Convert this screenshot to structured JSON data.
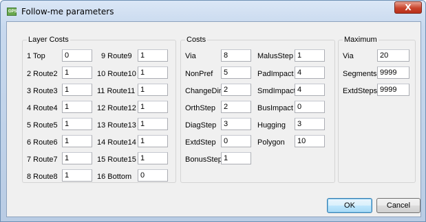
{
  "window": {
    "title": "Follow-me parameters",
    "close_glyph": "X"
  },
  "layer_costs": {
    "title": "Layer Costs",
    "left": [
      {
        "label": "1 Top",
        "value": "0"
      },
      {
        "label": "2 Route2",
        "value": "1"
      },
      {
        "label": "3 Route3",
        "value": "1"
      },
      {
        "label": "4 Route4",
        "value": "1"
      },
      {
        "label": "5 Route5",
        "value": "1"
      },
      {
        "label": "6 Route6",
        "value": "1"
      },
      {
        "label": "7 Route7",
        "value": "1"
      },
      {
        "label": "8 Route8",
        "value": "1"
      }
    ],
    "right": [
      {
        "label": "9 Route9",
        "value": "1"
      },
      {
        "label": "10 Route10",
        "value": "1"
      },
      {
        "label": "11 Route11",
        "value": "1"
      },
      {
        "label": "12 Route12",
        "value": "1"
      },
      {
        "label": "13 Route13",
        "value": "1"
      },
      {
        "label": "14 Route14",
        "value": "1"
      },
      {
        "label": "15 Route15",
        "value": "1"
      },
      {
        "label": "16 Bottom",
        "value": "0"
      }
    ]
  },
  "costs": {
    "title": "Costs",
    "left": [
      {
        "label": "Via",
        "value": "8"
      },
      {
        "label": "NonPref",
        "value": "5"
      },
      {
        "label": "ChangeDir",
        "value": "2"
      },
      {
        "label": "OrthStep",
        "value": "2"
      },
      {
        "label": "DiagStep",
        "value": "3"
      },
      {
        "label": "ExtdStep",
        "value": "0"
      },
      {
        "label": "BonusStep",
        "value": "1"
      }
    ],
    "right": [
      {
        "label": "MalusStep",
        "value": "1"
      },
      {
        "label": "PadImpact",
        "value": "4"
      },
      {
        "label": "SmdImpact",
        "value": "4"
      },
      {
        "label": "BusImpact",
        "value": "0"
      },
      {
        "label": "Hugging",
        "value": "3"
      },
      {
        "label": "Polygon",
        "value": "10"
      }
    ]
  },
  "maximum": {
    "title": "Maximum",
    "items": [
      {
        "label": "Via",
        "value": "20"
      },
      {
        "label": "Segments",
        "value": "9999"
      },
      {
        "label": "ExtdSteps",
        "value": "9999"
      }
    ]
  },
  "buttons": {
    "ok": "OK",
    "cancel": "Cancel"
  },
  "colors": {
    "title_bar": "#c8d9ee",
    "dialog_bg": "#f0f0f0",
    "close_button": "#c9442c",
    "default_button": "#bee6fd"
  }
}
